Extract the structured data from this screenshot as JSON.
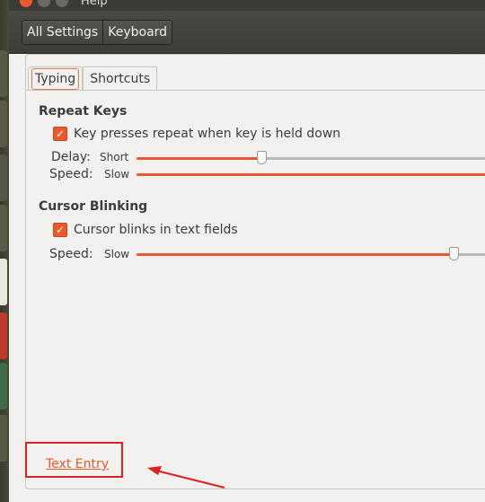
{
  "window": {
    "title": "Help"
  },
  "toolbar": {
    "all_settings": "All Settings",
    "keyboard": "Keyboard"
  },
  "tabs": [
    {
      "label": "Typing",
      "active": true
    },
    {
      "label": "Shortcuts",
      "active": false
    }
  ],
  "repeat_keys": {
    "title": "Repeat Keys",
    "checkbox_label": "Key presses repeat when key is held down",
    "checked": true,
    "delay": {
      "label": "Delay:",
      "min_label": "Short",
      "value_fraction": 0.36
    },
    "speed": {
      "label": "Speed:",
      "min_label": "Slow",
      "value_fraction": 1.0
    }
  },
  "cursor_blinking": {
    "title": "Cursor Blinking",
    "checkbox_label": "Cursor blinks in text fields",
    "checked": true,
    "speed": {
      "label": "Speed:",
      "min_label": "Slow",
      "value_fraction": 0.82
    }
  },
  "footer": {
    "link": "Text Entry"
  },
  "colors": {
    "accent": "#e9592b",
    "annotation": "#e02020"
  }
}
